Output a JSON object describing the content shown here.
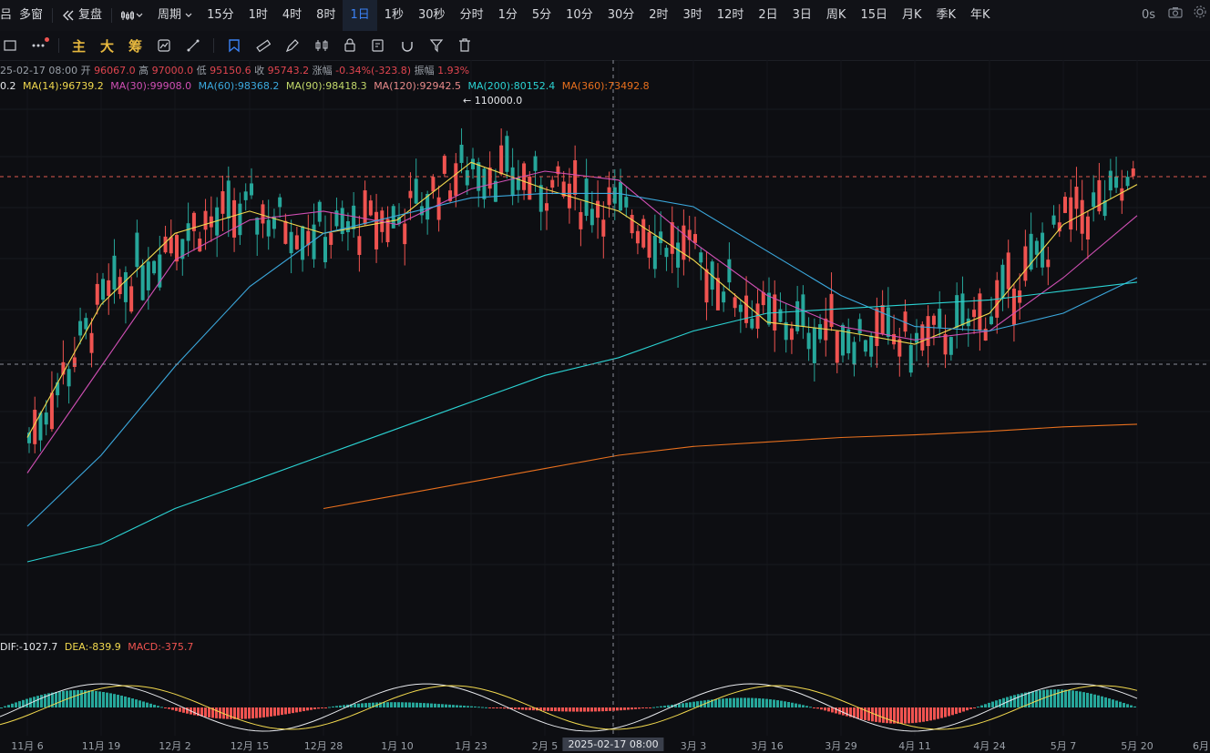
{
  "topbar": {
    "items": [
      "吕",
      "多窗",
      "复盘",
      "",
      "周期",
      "15分",
      "1时",
      "4时",
      "8时",
      "1日",
      "1秒",
      "30秒",
      "分时",
      "1分",
      "5分",
      "10分",
      "30分",
      "2时",
      "3时",
      "12时",
      "2日",
      "3日",
      "周K",
      "15日",
      "月K",
      "季K",
      "年K"
    ],
    "active": "1日",
    "timer": "0s",
    "icons": [
      "grid-icon",
      "replay-icon",
      "candles-icon",
      "chevron-down-icon",
      "camera-icon",
      "settings-icon"
    ]
  },
  "toolbar": {
    "main_label": "主",
    "big_label": "大",
    "chips_label": "筹"
  },
  "info": {
    "date": "25-02-17 08:00",
    "open_label": "开",
    "open": "96067.0",
    "high_label": "高",
    "high": "97000.0",
    "low_label": "低",
    "low": "95150.6",
    "close_label": "收",
    "close": "95743.2",
    "change_label": "涨幅",
    "change": "-0.34%(-323.8)",
    "amp_label": "振幅",
    "amp": "1.93%"
  },
  "ma": [
    {
      "label": "0.2",
      "color": "#e6e8ec"
    },
    {
      "label": "MA(14):96739.2",
      "color": "#f2d94e"
    },
    {
      "label": "MA(30):99908.0",
      "color": "#d04fb4"
    },
    {
      "label": "MA(60):98368.2",
      "color": "#3ba8dd"
    },
    {
      "label": "MA(90):98418.3",
      "color": "#c2d86a"
    },
    {
      "label": "MA(120):92942.5",
      "color": "#e88a8a"
    },
    {
      "label": "MA(200):80152.4",
      "color": "#2bd3d3"
    },
    {
      "label": "MA(360):73492.8",
      "color": "#e8701e"
    }
  ],
  "macd": {
    "dif": "DIF:-1027.7",
    "dea": "DEA:-839.9",
    "macd": "MACD:-375.7"
  },
  "annotations": {
    "high_marker": "110000.0"
  },
  "x_labels": [
    "11月 6",
    "11月 19",
    "12月 2",
    "12月 15",
    "12月 28",
    "1月 10",
    "1月 23",
    "2月 5",
    "3月 3",
    "3月 16",
    "3月 29",
    "4月 11",
    "4月 24",
    "5月 7",
    "5月 20",
    "6月"
  ],
  "crosshair_label": "2025-02-17 08:00",
  "colors": {
    "up": "#26a69a",
    "down": "#ef5350",
    "accent": "#3b82f6",
    "bg": "#0d0e12"
  },
  "chart_data": {
    "type": "candlestick",
    "interval": "1日",
    "x": [
      "11月 6",
      "11月 19",
      "12月 2",
      "12月 15",
      "12月 28",
      "1月 10",
      "1月 23",
      "2月 5",
      "2月 17",
      "3月 3",
      "3月 16",
      "3月 29",
      "4月 11",
      "4月 24",
      "5月 7",
      "5月 20"
    ],
    "series": [
      {
        "name": "MA(14)",
        "values": [
          72000,
          87000,
          95000,
          97500,
          95000,
          96500,
          103000,
          100000,
          97500,
          92000,
          85000,
          84000,
          82500,
          86000,
          96000,
          100500
        ]
      },
      {
        "name": "MA(30)",
        "values": [
          68000,
          80000,
          92000,
          96500,
          97500,
          96000,
          100000,
          102000,
          101000,
          94000,
          88000,
          84500,
          83000,
          84000,
          90000,
          97000
        ]
      },
      {
        "name": "MA(60)",
        "values": [
          62000,
          70000,
          80000,
          89000,
          95000,
          97000,
          99000,
          99500,
          99500,
          98000,
          93000,
          88000,
          84500,
          84000,
          86000,
          90000
        ]
      },
      {
        "name": "MA(200)",
        "values": [
          58000,
          60000,
          64000,
          67000,
          70000,
          73000,
          76000,
          79000,
          81000,
          84000,
          86000,
          86500,
          87000,
          87500,
          88500,
          89500
        ]
      },
      {
        "name": "MA(360)",
        "values": [
          null,
          null,
          null,
          null,
          64000,
          65500,
          67000,
          68500,
          70000,
          71000,
          71500,
          72000,
          72300,
          72700,
          73200,
          73500
        ]
      }
    ],
    "marker": {
      "label": "110000.0",
      "x": "1月 23"
    },
    "crosshair": {
      "x": "2月 17"
    }
  }
}
